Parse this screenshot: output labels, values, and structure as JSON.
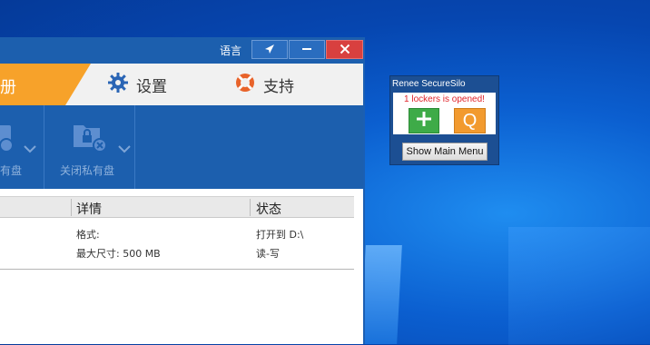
{
  "window": {
    "language_label": "语言",
    "title_buttons": [
      "send-icon",
      "minimize-icon",
      "close-icon"
    ]
  },
  "menu": {
    "register_partial": "册",
    "settings_label": "设置",
    "support_label": "支持"
  },
  "toolbar": {
    "tool1_label_partial": "有盘",
    "tool2_label": "关闭私有盘"
  },
  "table": {
    "headers": {
      "details": "详情",
      "status": "状态"
    },
    "row": {
      "details": [
        "格式:",
        "最大尺寸: 500 MB"
      ],
      "status": [
        "打开到 D:\\",
        "读-写"
      ]
    }
  },
  "widget": {
    "title": "Renee SecureSilo",
    "status": "1 lockers is opened!",
    "add_icon": "plus-icon",
    "q_label": "Q",
    "menu_button": "Show Main Menu"
  },
  "colors": {
    "desktop_blue": "#0b5fd0",
    "title_blue": "#1c5fae",
    "register_orange": "#f7a22a",
    "close_red": "#d8403f",
    "widget_add_green": "#3eab48",
    "widget_q_orange": "#f29a2e",
    "status_red": "#e0242b"
  }
}
